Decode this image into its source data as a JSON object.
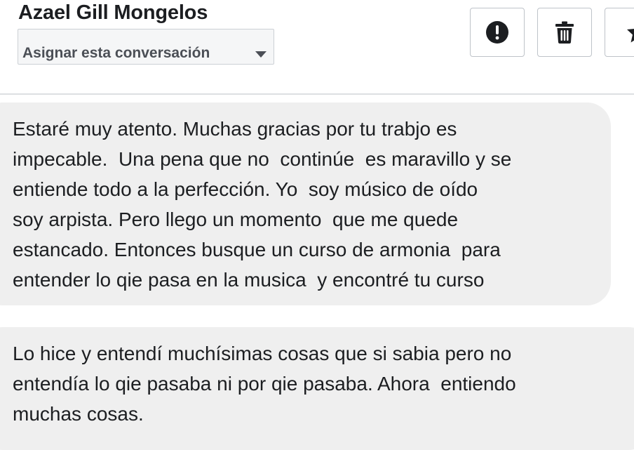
{
  "header": {
    "contact_name": "Azael Gill Mongelos",
    "assign_label": "Asignar esta conversación"
  },
  "actions": [
    {
      "name": "report",
      "icon": "exclamation-circle-icon"
    },
    {
      "name": "delete",
      "icon": "trash-icon"
    },
    {
      "name": "star",
      "icon": "star-icon"
    }
  ],
  "messages": [
    {
      "text": "Estaré muy atento. Muchas gracias por tu trabjo es\nimpecable.  Una pena que no  continúe  es maravillo y se\nentiende todo a la perfección. Yo  soy músico de oído\nsoy arpista. Pero llego un momento  que me quede\nestancado. Entonces busque un curso de armonia  para\nentender lo qie pasa en la musica  y encontré tu curso"
    },
    {
      "text": "Lo hice y entendí muchísimas cosas que si sabia pero no\nentendía lo qie pasaba ni por qie pasaba. Ahora  entiendo\nmuchas cosas."
    }
  ],
  "colors": {
    "bubble_bg": "#efefef",
    "text": "#1c1e21",
    "border": "#bec3c9",
    "divider": "#dddfe2"
  }
}
